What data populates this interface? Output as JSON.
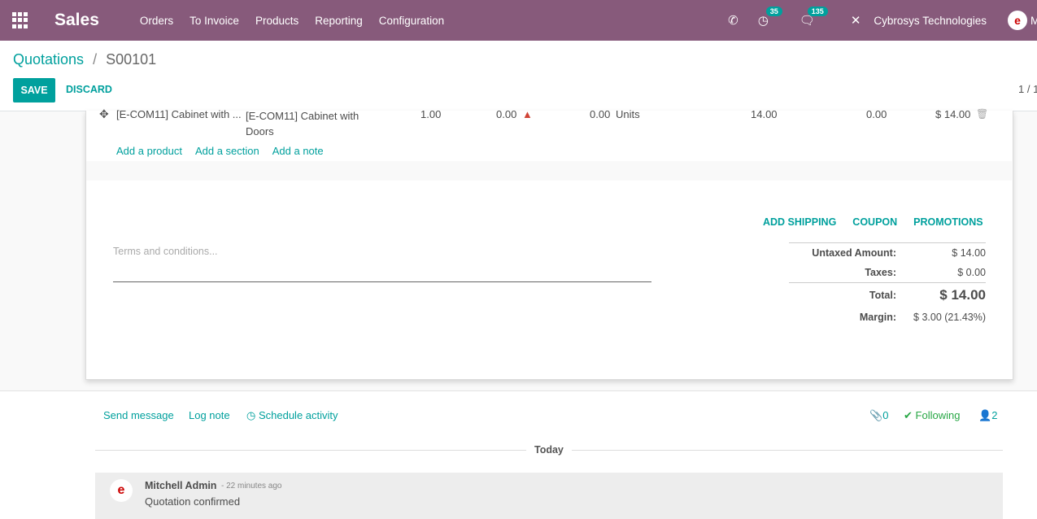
{
  "navbar": {
    "app_name": "Sales",
    "menu": [
      "Orders",
      "To Invoice",
      "Products",
      "Reporting",
      "Configuration"
    ],
    "activity_count": "35",
    "message_count": "135",
    "company": "Cybrosys Technologies",
    "user_initial": "M"
  },
  "breadcrumb": {
    "parent": "Quotations",
    "separator": "/",
    "current": "S00101"
  },
  "controls": {
    "save": "SAVE",
    "discard": "DISCARD",
    "pager": "1 / 1"
  },
  "order_line": {
    "product": "[E-COM11] Cabinet with ...",
    "description_1": "[E-COM11] Cabinet with",
    "description_2": "Doors",
    "quantity": "1.00",
    "delivered": "0.00",
    "invoiced": "0.00",
    "uom": "Units",
    "unit_price": "14.00",
    "discount": "0.00",
    "subtotal": "$ 14.00"
  },
  "add_links": {
    "product": "Add a product",
    "section": "Add a section",
    "note": "Add a note"
  },
  "terms_placeholder": "Terms and conditions...",
  "actions": {
    "shipping": "ADD SHIPPING",
    "coupon": "COUPON",
    "promotions": "PROMOTIONS"
  },
  "totals": {
    "untaxed_label": "Untaxed Amount:",
    "untaxed_value": "$ 14.00",
    "taxes_label": "Taxes:",
    "taxes_value": "$ 0.00",
    "total_label": "Total:",
    "total_value": "$ 14.00",
    "margin_label": "Margin:",
    "margin_value": "$ 3.00 (21.43%)"
  },
  "chatter": {
    "send_message": "Send message",
    "log_note": "Log note",
    "schedule_activity": "Schedule activity",
    "attachments": "0",
    "following": "Following",
    "followers": "2",
    "today": "Today",
    "message": {
      "author": "Mitchell Admin",
      "time": "- 22 minutes ago",
      "body": "Quotation confirmed"
    }
  },
  "colors": {
    "navbar": "#875a7b",
    "accent": "#00a09d",
    "following": "#28a745"
  }
}
